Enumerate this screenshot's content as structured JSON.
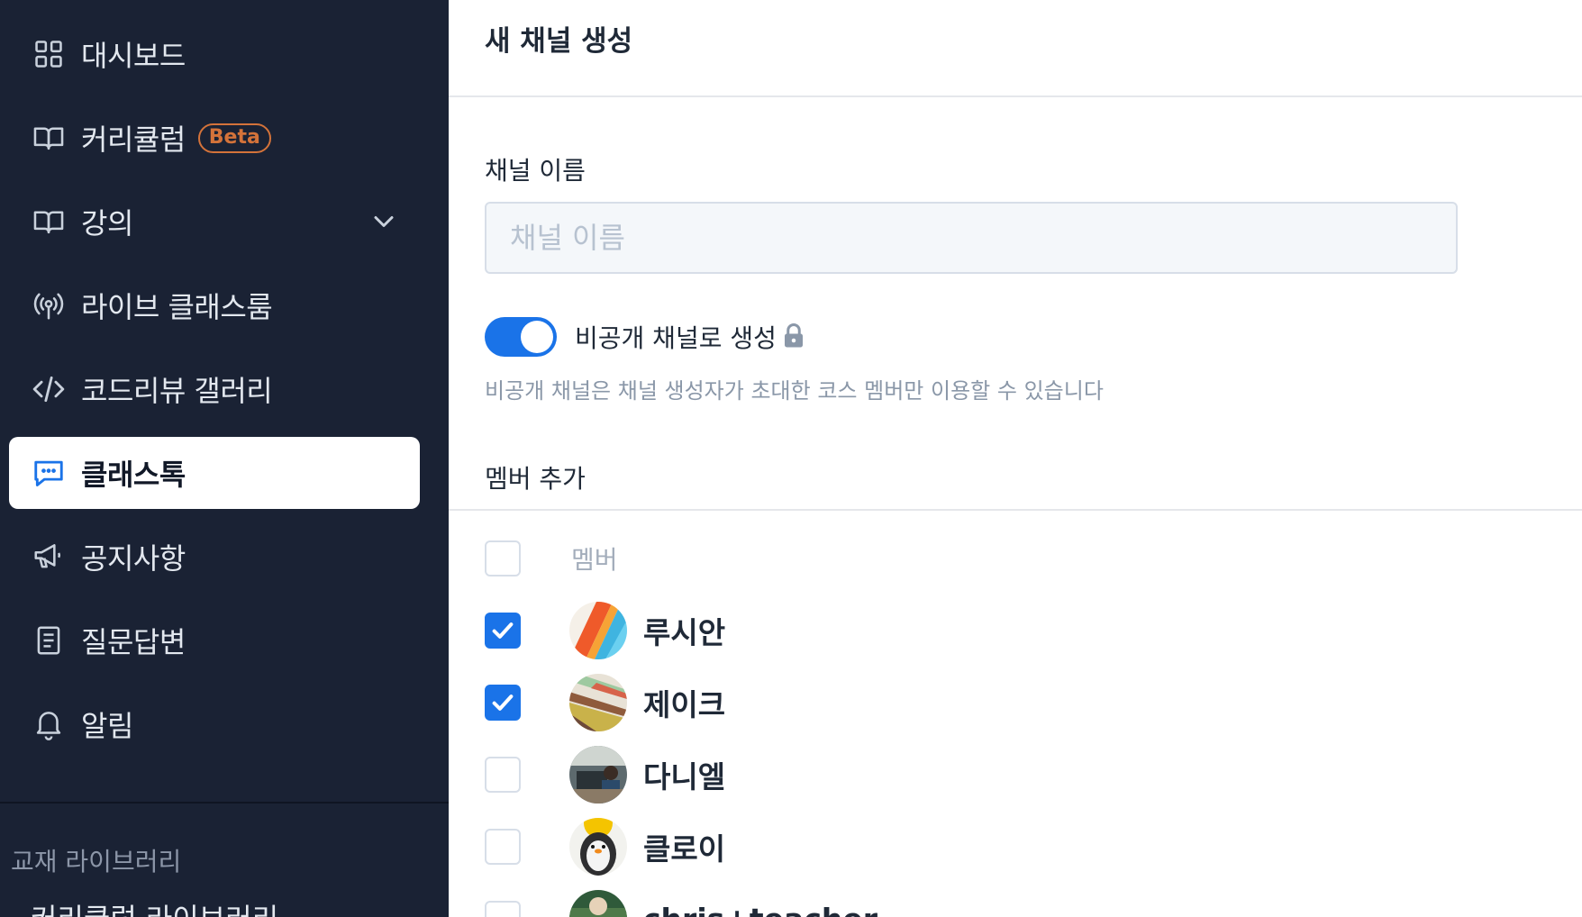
{
  "sidebar": {
    "items": [
      {
        "label": "대시보드",
        "icon": "grid-icon"
      },
      {
        "label": "커리큘럼",
        "icon": "book-icon",
        "badge": "Beta"
      },
      {
        "label": "강의",
        "icon": "book-icon",
        "expandable": true
      },
      {
        "label": "라이브 클래스룸",
        "icon": "broadcast-icon"
      },
      {
        "label": "코드리뷰 갤러리",
        "icon": "code-icon"
      },
      {
        "label": "클래스톡",
        "icon": "chat-icon",
        "active": true
      },
      {
        "label": "공지사항",
        "icon": "megaphone-icon"
      },
      {
        "label": "질문답변",
        "icon": "document-icon"
      },
      {
        "label": "알림",
        "icon": "bell-icon"
      }
    ],
    "section_title": "교재 라이브러리",
    "section_item": "커리큘럼 라이브러리"
  },
  "page": {
    "title": "새 채널 생성"
  },
  "form": {
    "channel_name_label": "채널 이름",
    "channel_name_placeholder": "채널 이름",
    "channel_name_value": "",
    "private_toggle_label": "비공개 채널로 생성",
    "private_toggle_on": true,
    "private_helper": "비공개 채널은 채널 생성자가 초대한 코스 멤버만 이용할 수 있습니다",
    "member_section_label": "멤버 추가"
  },
  "members": {
    "header": "멤버",
    "list": [
      {
        "name": "루시안",
        "checked": true
      },
      {
        "name": "제이크",
        "checked": true
      },
      {
        "name": "다니엘",
        "checked": false
      },
      {
        "name": "클로이",
        "checked": false
      },
      {
        "name": "chris+teacher",
        "checked": false
      }
    ]
  },
  "colors": {
    "sidebar_bg": "#1a2234",
    "accent": "#1a73e8",
    "beta": "#d4733a"
  }
}
